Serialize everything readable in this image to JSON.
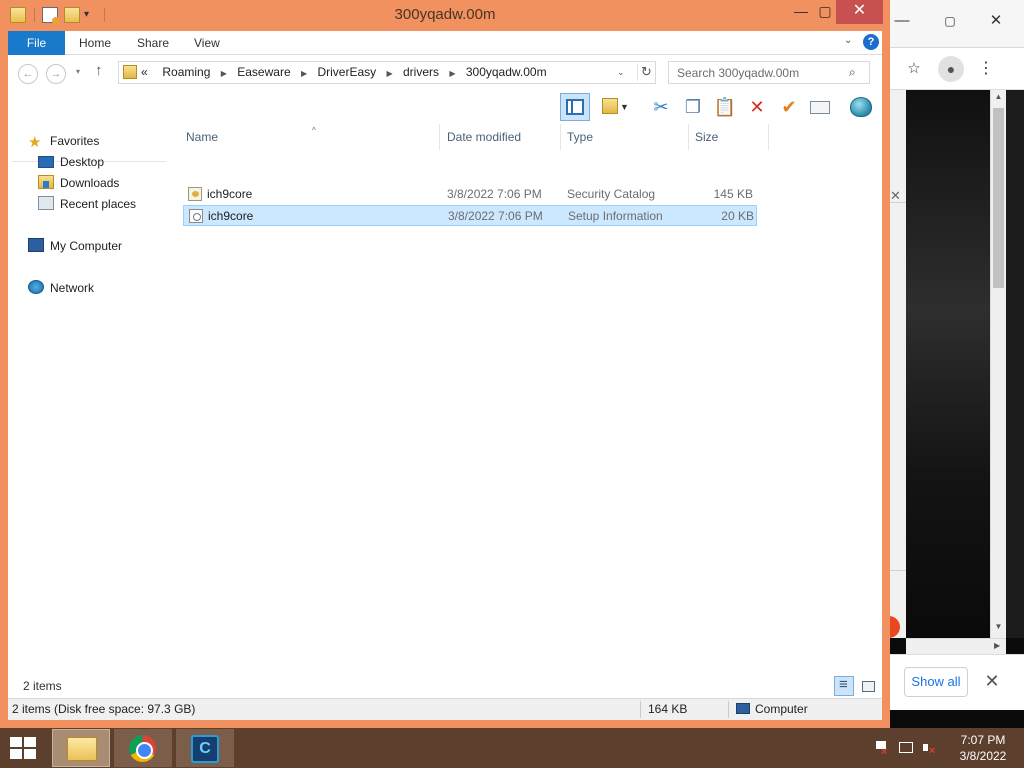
{
  "window": {
    "title": "300yqadw.00m"
  },
  "ribbon": {
    "tabs": [
      "File",
      "Home",
      "Share",
      "View"
    ]
  },
  "address": {
    "overflow": "«",
    "crumbs": [
      "Roaming",
      "Easeware",
      "DriverEasy",
      "drivers",
      "300yqadw.00m"
    ]
  },
  "search": {
    "placeholder": "Search 300yqadw.00m"
  },
  "nav": {
    "favorites": "Favorites",
    "desktop": "Desktop",
    "downloads": "Downloads",
    "recent": "Recent places",
    "computer": "My Computer",
    "network": "Network"
  },
  "columns": {
    "name": "Name",
    "date": "Date modified",
    "type": "Type",
    "size": "Size"
  },
  "files": [
    {
      "name": "ich9core",
      "date": "3/8/2022 7:06 PM",
      "type": "Security Catalog",
      "size": "145 KB",
      "icon": "security-catalog-icon",
      "selected": false
    },
    {
      "name": "ich9core",
      "date": "3/8/2022 7:06 PM",
      "type": "Setup Information",
      "size": "20 KB",
      "icon": "setup-information-icon",
      "selected": true
    }
  ],
  "status": {
    "item_count": "2 items",
    "bar_items": "2 items (Disk free space: 97.3 GB)",
    "bar_size": "164 KB",
    "bar_location": "Computer"
  },
  "chrome": {
    "show_all": "Show all"
  },
  "clock": {
    "time": "7:07 PM",
    "date": "3/8/2022"
  },
  "colors": {
    "window_frame": "#f0915f",
    "file_tab": "#1979ca",
    "selection": "#cce8ff",
    "taskbar": "#5c3f2d",
    "close_button": "#c75050"
  }
}
